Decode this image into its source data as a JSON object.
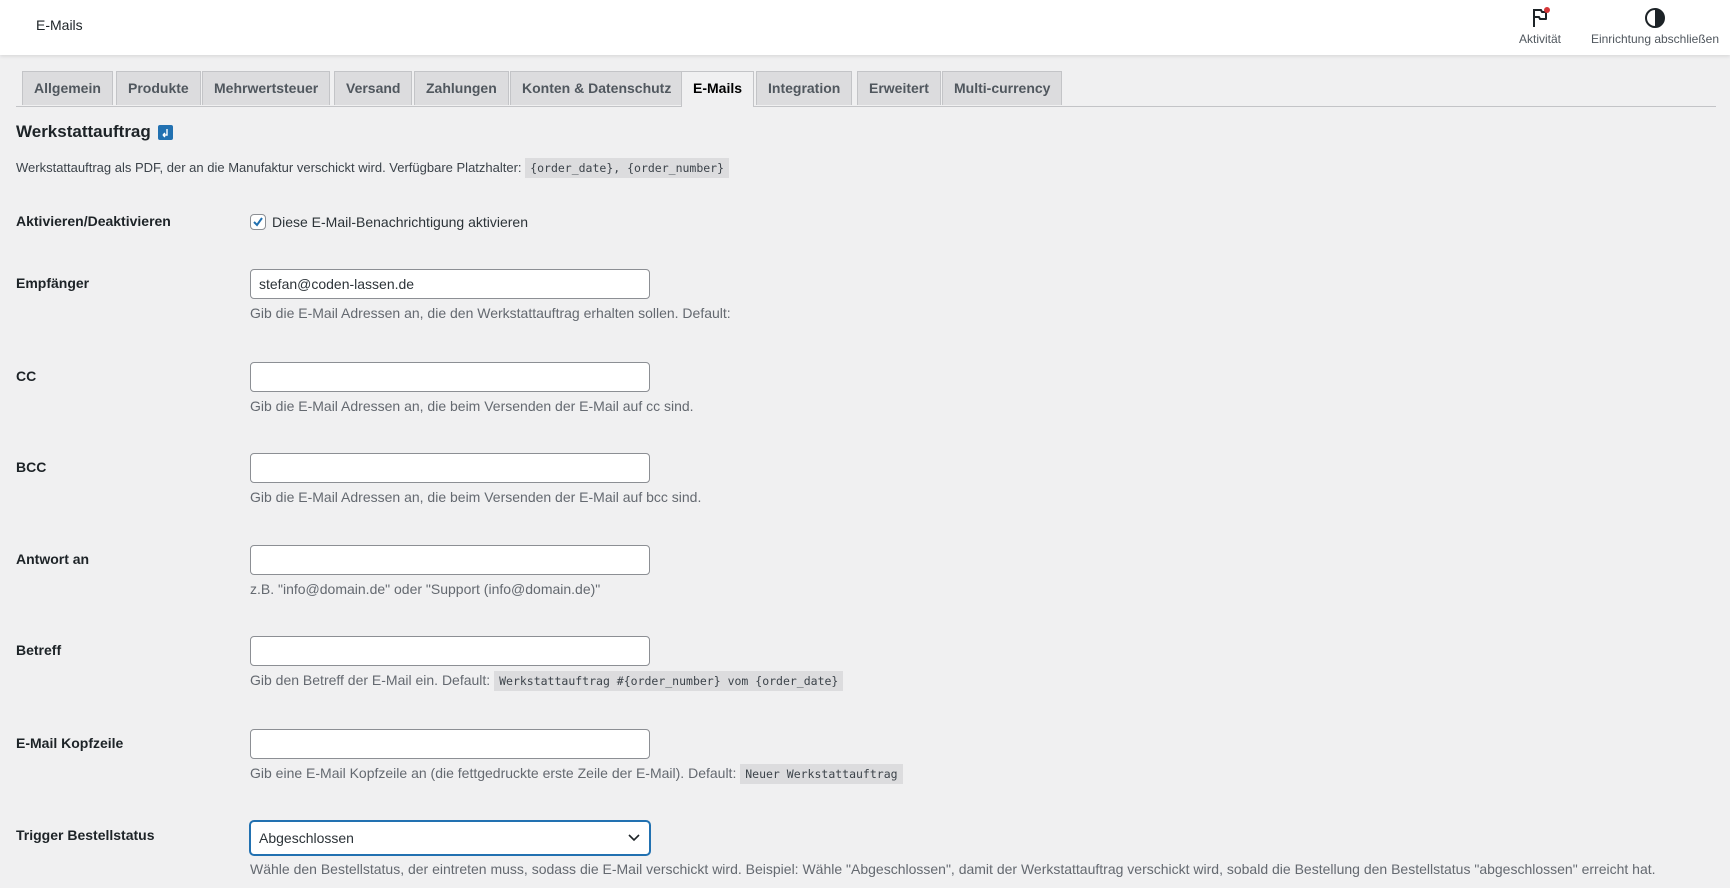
{
  "header": {
    "title": "E-Mails",
    "activity_label": "Aktivität",
    "setup_label": "Einrichtung abschließen"
  },
  "tabs": [
    {
      "label": "Allgemein"
    },
    {
      "label": "Produkte"
    },
    {
      "label": "Mehrwertsteuer"
    },
    {
      "label": "Versand"
    },
    {
      "label": "Zahlungen"
    },
    {
      "label": "Konten & Datenschutz"
    },
    {
      "label": "E-Mails",
      "active": true
    },
    {
      "label": "Integration"
    },
    {
      "label": "Erweitert"
    },
    {
      "label": "Multi-currency"
    }
  ],
  "section": {
    "title": "Werkstattauftrag",
    "intro_text": "Werkstattauftrag als PDF, der an die Manufaktur verschickt wird. Verfügbare Platzhalter:",
    "intro_code": "{order_date}, {order_number}"
  },
  "fields": {
    "enable": {
      "label": "Aktivieren/Deaktivieren",
      "checkbox_label": "Diese E-Mail-Benachrichtigung aktivieren",
      "checked": true
    },
    "recipient": {
      "label": "Empfänger",
      "value": "stefan@coden-lassen.de",
      "desc": "Gib die E-Mail Adressen an, die den Werkstattauftrag erhalten sollen. Default:"
    },
    "cc": {
      "label": "CC",
      "value": "",
      "desc": "Gib die E-Mail Adressen an, die beim Versenden der E-Mail auf cc sind."
    },
    "bcc": {
      "label": "BCC",
      "value": "",
      "desc": "Gib die E-Mail Adressen an, die beim Versenden der E-Mail auf bcc sind."
    },
    "reply_to": {
      "label": "Antwort an",
      "value": "",
      "desc": "z.B. \"info@domain.de\" oder \"Support (info@domain.de)\""
    },
    "subject": {
      "label": "Betreff",
      "value": "",
      "desc": "Gib den Betreff der E-Mail ein. Default:",
      "default_code": "Werkstattauftrag #{order_number} vom {order_date}"
    },
    "heading": {
      "label": "E-Mail Kopfzeile",
      "value": "",
      "desc": "Gib eine E-Mail Kopfzeile an (die fettgedruckte erste Zeile der E-Mail). Default:",
      "default_code": "Neuer Werkstattauftrag"
    },
    "trigger": {
      "label": "Trigger Bestellstatus",
      "selected": "Abgeschlossen",
      "desc": "Wähle den Bestellstatus, der eintreten muss, sodass die E-Mail verschickt wird. Beispiel: Wähle \"Abgeschlossen\", damit der Werkstattauftrag verschickt wird, sobald die Bestellung den Bestellstatus \"abgeschlossen\" erreicht hat."
    }
  },
  "colors": {
    "accent": "#2271b1",
    "background": "#f0f0f1",
    "notification_dot": "#d63638"
  }
}
